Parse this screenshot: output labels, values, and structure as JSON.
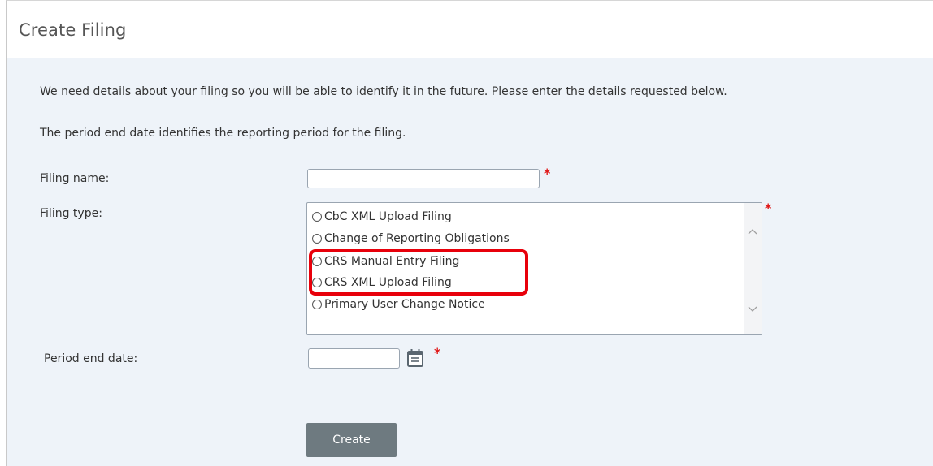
{
  "header": {
    "title": "Create Filing"
  },
  "intro": {
    "line1": "We need details about your filing so you will be able to identify it in the future. Please enter the details requested below.",
    "line2": "The period end date identifies the reporting period for the filing."
  },
  "form": {
    "filing_name": {
      "label": "Filing name:",
      "value": "",
      "required_mark": "*"
    },
    "filing_type": {
      "label": "Filing type:",
      "required_mark": "*",
      "options": [
        {
          "label": "CbC XML Upload Filing",
          "selected": false
        },
        {
          "label": "Change of Reporting Obligations",
          "selected": false
        },
        {
          "label": "CRS Manual Entry Filing",
          "selected": false,
          "highlighted": true
        },
        {
          "label": "CRS XML Upload Filing",
          "selected": false,
          "highlighted": true
        },
        {
          "label": "Primary User Change Notice",
          "selected": false
        }
      ]
    },
    "period_end_date": {
      "label": "Period end date:",
      "value": "",
      "required_mark": "*"
    },
    "create_label": "Create"
  },
  "colors": {
    "panel_background": "#eef3f9",
    "required": "#e01515",
    "highlight_border": "#e8000b",
    "button_background": "#6e7a80"
  },
  "icons": {
    "calendar": "calendar-icon",
    "scroll_up": "chevron-up-icon",
    "scroll_down": "chevron-down-icon"
  }
}
